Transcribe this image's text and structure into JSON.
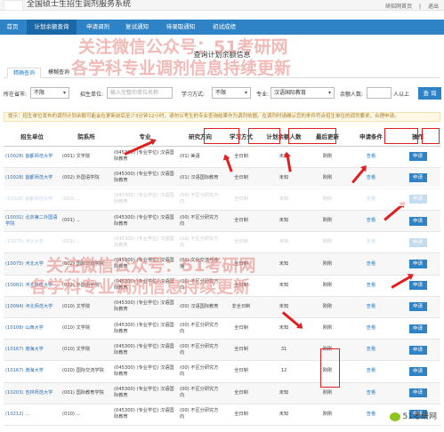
{
  "topbar": {
    "title": "全国硕士生招生调剂服务系统",
    "links": [
      "研招网首页",
      "|",
      "退出"
    ]
  },
  "nav": {
    "items": [
      "首页",
      "计划余额查询",
      "申请调剂",
      "复试通知",
      "待录取通知",
      "初试成绩"
    ],
    "active_index": 1
  },
  "panel": {
    "title": "查询计划余额信息"
  },
  "tabs": [
    "精确查询",
    "模糊查询"
  ],
  "filters": {
    "location_label": "所在省市:",
    "location_value": "不限",
    "unit_label": "招生单位:",
    "unit_placeholder": "输入完整的单位名称",
    "mode_label": "学习方式:",
    "mode_value": "不限",
    "major_label": "专业:",
    "major_value": "汉语国际教育",
    "remain_label": "余额人数:",
    "remain_suffix": "人以上",
    "query_button": "查 询"
  },
  "notice": "提示：招生单位发布的调剂计划余额可能会在更新前后至少3分钟12小时，请勿以考生的专业查询结果作为调剂依据。在调剂时请确认您的条件符合招生单位的调剂要求，合理申请。",
  "table": {
    "columns": [
      "招生单位",
      "院系所",
      "专业",
      "研究方向",
      "学习方式",
      "计划余额人数",
      "最后更新",
      "申请条件",
      "操作"
    ],
    "rows": [
      [
        "(10028) 首都师范大学",
        "(001) 文学院",
        "(045300) (专业学位) 汉语国际教育",
        "(01) 美语",
        "全日制",
        "未知",
        "刚刚",
        "查看",
        "申请"
      ],
      [
        "(10028) 首都师范大学",
        "(002) 外国语学院",
        "(045300) (专业学位) 汉语国际教育",
        "(01) 汉语国际教育",
        "全日制",
        "未知",
        "刚刚",
        "查看",
        "申请"
      ],
      [
        "(10028) 首都师范大学",
        "(003) ...",
        "(045300) (专业学位) 汉语国际教育",
        "(00) 不区分研究方向",
        "全日制",
        "未知",
        "刚刚",
        "查看",
        "申请"
      ],
      [
        "(10031) 北京第二外国语学院",
        "(001) ...",
        "(045300) (专业学位) 汉语国际教育",
        "(00) 不区分研究方向",
        "全日制",
        "未知",
        "刚刚",
        "查看",
        "申请"
      ],
      [
        "(10075) 河北大学",
        "(001) ...",
        "(045300) (专业学位) 汉语国际教育",
        "(00) 不区分研究方向",
        "全日制",
        "未知",
        "刚刚",
        "查看",
        "申请"
      ],
      [
        "(10075) 河北大学",
        "(002) 国际交流学院",
        "(045300) (专业学位) 汉语国际教育",
        "(01) 文化交流与传播",
        "全日制",
        "未知",
        "刚刚",
        "查看",
        "申请"
      ],
      [
        "(10082) 河北科技大学",
        "(012) 外国语学院",
        "(045300) (专业学位) 汉语国际教育",
        "(00) 不区分研究方向",
        "全日制",
        "未知",
        "刚刚",
        "查看",
        "申请"
      ],
      [
        "(10094) 河北师范大学",
        "(010) 文学院",
        "(045300) (专业学位) 汉语国际教育",
        "(00) 汉语国际教育",
        "非全日制",
        "未知",
        "刚刚",
        "查看",
        "申请"
      ],
      [
        "(10108) 山西大学",
        "(010) 文学院",
        "(045300) (专业学位) 汉语国际教育",
        "(00) 不区分研究方向",
        "全日制",
        "未知",
        "刚刚",
        "查看",
        "申请"
      ],
      [
        "(10167) 渤海大学",
        "(010) 文学院",
        "(045300) (专业学位) 汉语国际教育",
        "(00) 不区分研究方向",
        "全日制",
        "31",
        "刚刚",
        "查看",
        "申请"
      ],
      [
        "(10167) 渤海大学",
        "(020) 国际交流学院",
        "(045300) (专业学位) 汉语国际教育",
        "(00) 不区分研究方向",
        "全日制",
        "12",
        "刚刚",
        "查看",
        "申请"
      ],
      [
        "(10203) 吉林师范大学",
        "(001) 国际教育学院",
        "(045300) (专业学位) 汉语国际教育",
        "(00) 不区分研究方向",
        "全日制",
        "未知",
        "刚刚",
        "查看",
        "申请"
      ],
      [
        "(10212) ...",
        "(010) ...",
        "(045300) (专业学位) 汉语国际教育",
        "(00) 不区分研究方向",
        "全日制",
        "未知",
        "刚刚",
        "查看",
        "申请"
      ]
    ]
  },
  "watermarks": [
    "关注微信公众号：51考研网",
    "各学科专业调剂信息持续更新",
    "关注微信公众号：51考研网",
    "各学科专业调剂信息持续更新"
  ],
  "wechat_badge": "51考研网",
  "colors": {
    "nav": "#2d83c6",
    "annotation": "#e02020",
    "watermark": "#e8827a"
  }
}
